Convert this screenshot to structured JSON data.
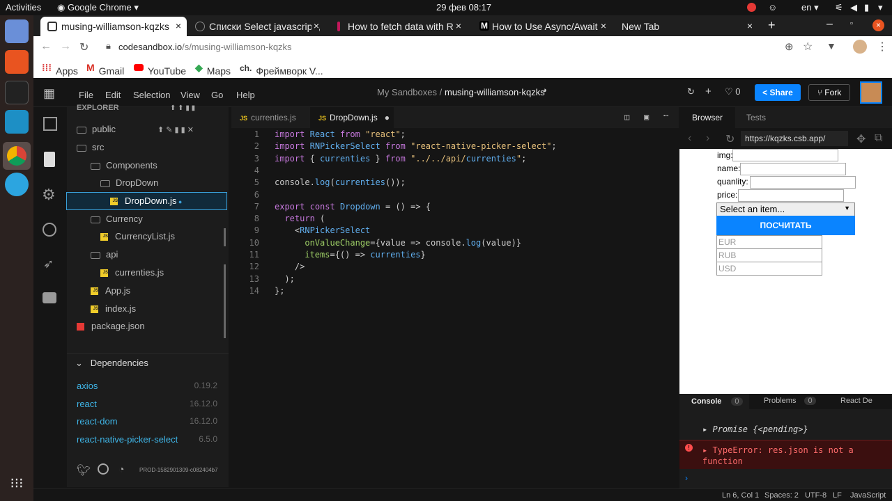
{
  "gnome": {
    "activities": "Activities",
    "app": "Google Chrome",
    "clock": "29 фев  08:17",
    "lang": "en"
  },
  "tabs": [
    {
      "title": "musing-williamson-kqzks",
      "close": "×"
    },
    {
      "title": "Списки Select javascript ,",
      "close": "×"
    },
    {
      "title": "How to fetch data with Re",
      "close": "×"
    },
    {
      "title": "How to Use Async/Await",
      "close": "×"
    },
    {
      "title": "New Tab",
      "close": "×"
    }
  ],
  "address": {
    "domain": "codesandbox.io",
    "path": "/s/musing-williamson-kqzks"
  },
  "bookmarks": [
    "Apps",
    "Gmail",
    "YouTube",
    "Maps",
    "Фреймворк V..."
  ],
  "csmenu": [
    "File",
    "Edit",
    "Selection",
    "View",
    "Go",
    "Help"
  ],
  "breadcrumb": {
    "parent": "My Sandboxes /",
    "name": "musing-williamson-kqzks"
  },
  "top_actions": {
    "likes": "0",
    "share": "Share",
    "fork": "Fork"
  },
  "explorer": {
    "header": "EXPLORER",
    "items": [
      {
        "label": "public",
        "type": "folder",
        "indent": 0
      },
      {
        "label": "src",
        "type": "folder",
        "indent": 0
      },
      {
        "label": "Components",
        "type": "folder",
        "indent": 1
      },
      {
        "label": "DropDown",
        "type": "folder",
        "indent": 2
      },
      {
        "label": "DropDown.js",
        "type": "js",
        "indent": 3
      },
      {
        "label": "Currency",
        "type": "folder",
        "indent": 1
      },
      {
        "label": "CurrencyList.js",
        "type": "js",
        "indent": 2
      },
      {
        "label": "api",
        "type": "folder",
        "indent": 1
      },
      {
        "label": "currenties.js",
        "type": "js",
        "indent": 2
      },
      {
        "label": "App.js",
        "type": "js",
        "indent": 1
      },
      {
        "label": "index.js",
        "type": "js",
        "indent": 1
      },
      {
        "label": "package.json",
        "type": "pkg",
        "indent": 0
      }
    ],
    "deps_title": "Dependencies",
    "deps": [
      {
        "name": "axios",
        "version": "0.19.2"
      },
      {
        "name": "react",
        "version": "16.12.0"
      },
      {
        "name": "react-dom",
        "version": "16.12.0"
      },
      {
        "name": "react-native-picker-select",
        "version": "6.5.0"
      }
    ],
    "build": "PROD-1582901309-c082404b7"
  },
  "editor_tabs": [
    {
      "label": "currenties.js"
    },
    {
      "label": "DropDown.js"
    }
  ],
  "code_lines": [
    "import React from \"react\";",
    "import RNPickerSelect from \"react-native-picker-select\";",
    "import { currenties } from \"../../api/currenties\";",
    "",
    "console.log(currenties());",
    "",
    "export const Dropdown = () => {",
    "  return (",
    "    <RNPickerSelect",
    "      onValueChange={value => console.log(value)}",
    "      items={() => currenties}",
    "    />",
    "  );",
    "};"
  ],
  "browser": {
    "tabs": [
      "Browser",
      "Tests"
    ],
    "url": "https://kqzks.csb.app/",
    "form": {
      "img": "img:",
      "name": "name:",
      "quantity": "quanlity:",
      "price": "price:",
      "select": "Select an item...",
      "button": "ПОСЧИТАТЬ"
    },
    "currencies": [
      "EUR",
      "RUB",
      "USD"
    ]
  },
  "console": {
    "tabs": [
      {
        "label": "Console",
        "count": "0"
      },
      {
        "label": "Problems",
        "count": "0"
      },
      {
        "label": "React De",
        "count": ""
      }
    ],
    "promise": "Promise {<pending>}",
    "error": "TypeError: res.json is not a function",
    "prompt": "›"
  },
  "status": {
    "pos": "Ln 6, Col 1",
    "spaces": "Spaces: 2",
    "enc": "UTF-8",
    "eol": "LF",
    "lang": "JavaScript"
  },
  "colors": {
    "accent": "#0971f1",
    "blue_button": "#0a84ff",
    "error_bg": "#3b0f0f",
    "error_fg": "#ff6b6b"
  }
}
